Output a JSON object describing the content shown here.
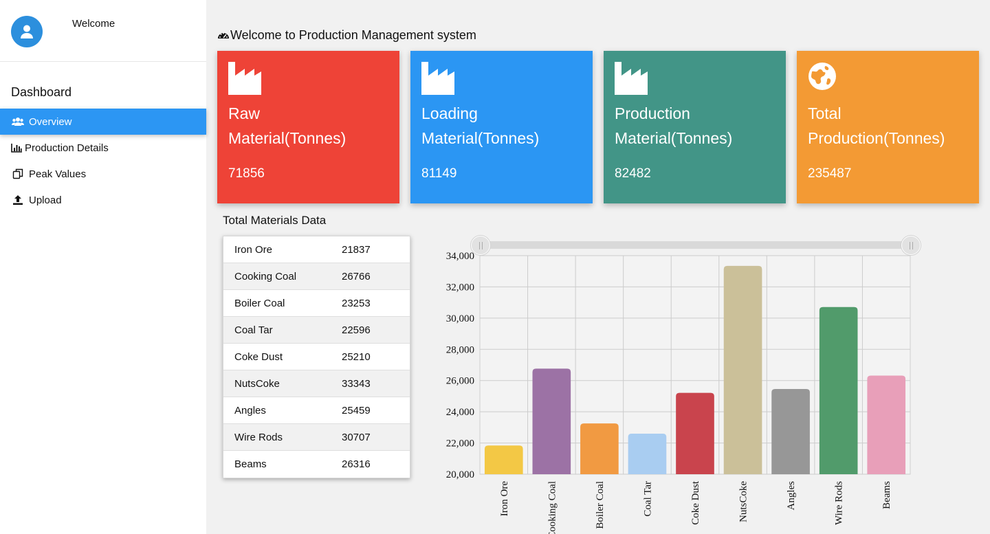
{
  "sidebar": {
    "welcome": "Welcome",
    "section_title": "Dashboard",
    "items": [
      {
        "label": "Overview",
        "icon": "users-icon"
      },
      {
        "label": "Production Details",
        "icon": "bar-chart-icon"
      },
      {
        "label": "Peak Values",
        "icon": "copy-icon"
      },
      {
        "label": "Upload",
        "icon": "upload-icon"
      }
    ]
  },
  "header": {
    "title": "Welcome to Production Management system"
  },
  "cards": [
    {
      "line1": "Raw",
      "line2": "Material(Tonnes)",
      "value": "71856",
      "color": "#ee4337",
      "icon": "factory-icon"
    },
    {
      "line1": "Loading",
      "line2": "Material(Tonnes)",
      "value": "81149",
      "color": "#2b96f3",
      "icon": "factory-icon"
    },
    {
      "line1": "Production",
      "line2": "Material(Tonnes)",
      "value": "82482",
      "color": "#429587",
      "icon": "factory-icon"
    },
    {
      "line1": "Total",
      "line2": "Production(Tonnes)",
      "value": "235487",
      "color": "#f39a34",
      "icon": "globe-icon"
    }
  ],
  "table": {
    "title": "Total Materials Data",
    "rows": [
      {
        "name": "Iron Ore",
        "value": "21837"
      },
      {
        "name": "Cooking Coal",
        "value": "26766"
      },
      {
        "name": "Boiler Coal",
        "value": "23253"
      },
      {
        "name": "Coal Tar",
        "value": "22596"
      },
      {
        "name": "Coke Dust",
        "value": "25210"
      },
      {
        "name": "NutsCoke",
        "value": "33343"
      },
      {
        "name": "Angles",
        "value": "25459"
      },
      {
        "name": "Wire Rods",
        "value": "30707"
      },
      {
        "name": "Beams",
        "value": "26316"
      }
    ]
  },
  "chart_data": {
    "type": "bar",
    "categories": [
      "Iron Ore",
      "Cooking Coal",
      "Boiler Coal",
      "Coal Tar",
      "Coke Dust",
      "NutsCoke",
      "Angles",
      "Wire Rods",
      "Beams"
    ],
    "values": [
      21837,
      26766,
      23253,
      22596,
      25210,
      33343,
      25459,
      30707,
      26316
    ],
    "colors": [
      "#f3c845",
      "#9c72a5",
      "#f19a42",
      "#a9cdf1",
      "#c9444d",
      "#cbc099",
      "#979797",
      "#519b6b",
      "#e89fb9"
    ],
    "ylim": [
      20000,
      34000
    ],
    "yticks": [
      "20,000",
      "22,000",
      "24,000",
      "26,000",
      "28,000",
      "30,000",
      "32,000",
      "34,000"
    ],
    "grid": true,
    "title": "",
    "xlabel": "",
    "ylabel": ""
  }
}
